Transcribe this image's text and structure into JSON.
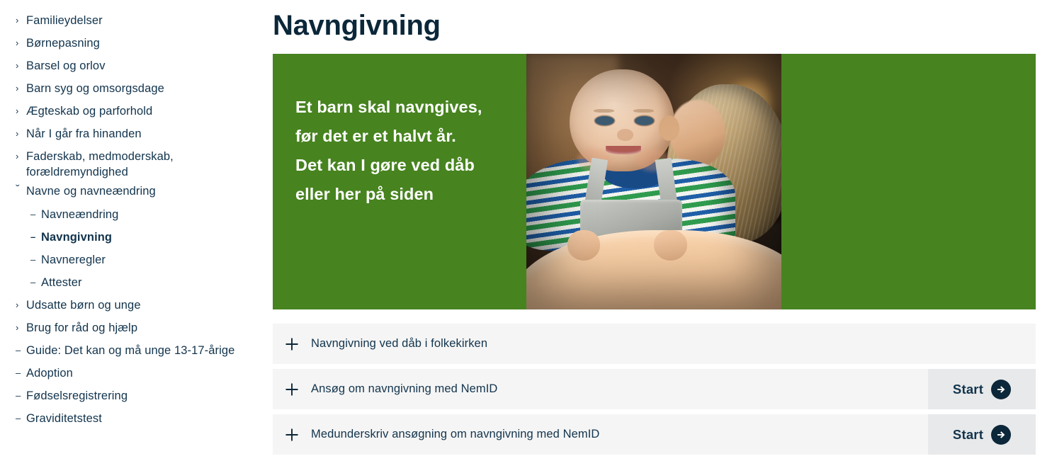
{
  "sidebar": {
    "items": [
      {
        "label": "Familieydelser",
        "marker": "chevron-right",
        "level": 1,
        "current": false
      },
      {
        "label": "Børnepasning",
        "marker": "chevron-right",
        "level": 1,
        "current": false
      },
      {
        "label": "Barsel og orlov",
        "marker": "chevron-right",
        "level": 1,
        "current": false
      },
      {
        "label": "Barn syg og omsorgsdage",
        "marker": "chevron-right",
        "level": 1,
        "current": false
      },
      {
        "label": "Ægteskab og parforhold",
        "marker": "chevron-right",
        "level": 1,
        "current": false
      },
      {
        "label": "Når I går fra hinanden",
        "marker": "chevron-right",
        "level": 1,
        "current": false
      },
      {
        "label": "Faderskab, medmoderskab, forældremyndighed",
        "marker": "chevron-right",
        "level": 1,
        "current": false,
        "wrapped": true
      },
      {
        "label": "Navne og navneændring",
        "marker": "chevron-down",
        "level": 1,
        "current": false
      },
      {
        "label": "Navneændring",
        "marker": "dash",
        "level": 2,
        "current": false
      },
      {
        "label": "Navngivning",
        "marker": "dash",
        "level": 2,
        "current": true
      },
      {
        "label": "Navneregler",
        "marker": "dash",
        "level": 2,
        "current": false
      },
      {
        "label": "Attester",
        "marker": "dash",
        "level": 2,
        "current": false
      },
      {
        "label": "Udsatte børn og unge",
        "marker": "chevron-right",
        "level": 1,
        "current": false
      },
      {
        "label": "Brug for råd og hjælp",
        "marker": "chevron-right",
        "level": 1,
        "current": false
      },
      {
        "label": "Guide: Det kan og må unge 13-17-årige",
        "marker": "dash",
        "level": 1,
        "current": false
      },
      {
        "label": "Adoption",
        "marker": "dash",
        "level": 1,
        "current": false
      },
      {
        "label": "Fødselsregistrering",
        "marker": "dash",
        "level": 1,
        "current": false
      },
      {
        "label": "Graviditetstest",
        "marker": "dash",
        "level": 1,
        "current": false
      }
    ]
  },
  "main": {
    "title": "Navngivning",
    "hero": {
      "background_color": "#47831f",
      "lines": [
        "Et barn skal navngives,",
        "før det er et halvt år.",
        "Det kan I gøre ved dåb",
        "eller her på siden"
      ],
      "photo_alt": "Baby holdt af kvinde"
    },
    "accordion": [
      {
        "title": "Navngivning ved dåb i folkekirken",
        "icon": "plus-icon",
        "start": null
      },
      {
        "title": "Ansøg om navngivning med NemID",
        "icon": "plus-icon",
        "start": "Start"
      },
      {
        "title": "Medunderskriv ansøgning om navngivning med NemID",
        "icon": "plus-icon",
        "start": "Start"
      }
    ]
  },
  "colors": {
    "green": "#47831f",
    "navy": "#12344d",
    "title_navy": "#0b2739",
    "row_bg": "#f5f5f5",
    "start_bg": "#e8e9ea"
  }
}
